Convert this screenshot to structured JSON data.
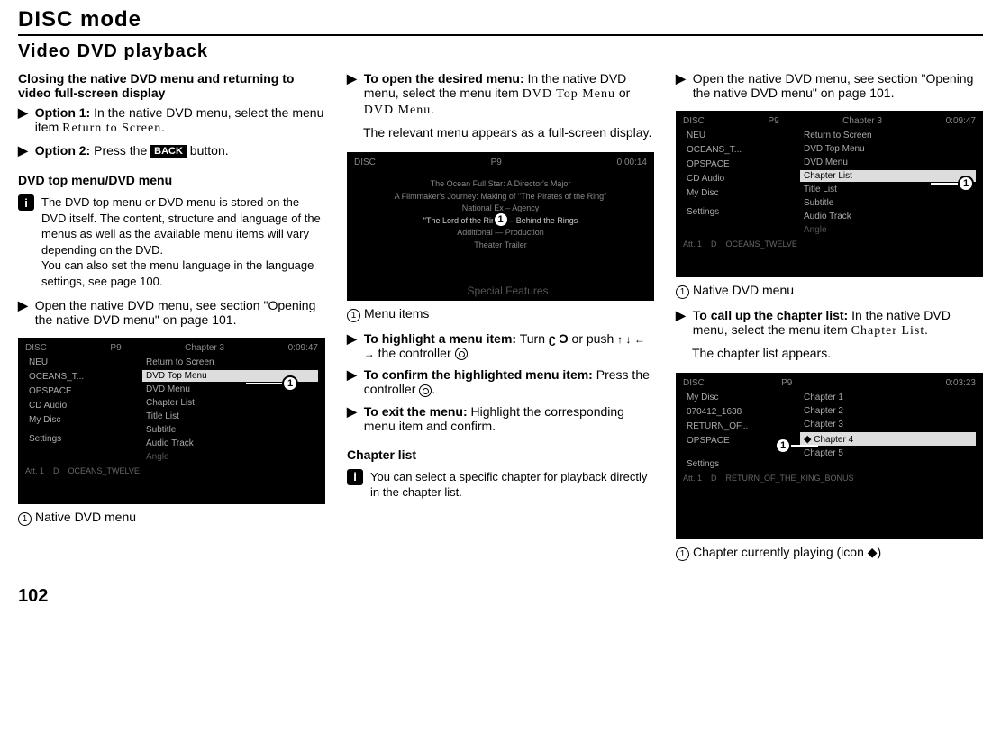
{
  "page": {
    "title": "DISC mode",
    "subtitle": "Video DVD playback",
    "pageNumber": "102"
  },
  "col1": {
    "heading1": "Closing the native DVD menu and returning to video full-screen display",
    "option1_bold": "Option 1:",
    "option1_text": " In the native DVD menu, select the menu item ",
    "option1_menu": "Return to Screen.",
    "option2_bold": "Option 2:",
    "option2_text": " Press the ",
    "option2_back": "BACK",
    "option2_text2": " button.",
    "heading2": "DVD top menu/DVD menu",
    "info1": "The DVD top menu or DVD menu is stored on the DVD itself. The content, structure and language of the menus as well as the available menu items will vary depending on the DVD.",
    "info1b": "You can also set the menu language in the language settings, see page 100.",
    "step1": "Open the native DVD menu, see section \"Opening the native DVD menu\" on page 101.",
    "caption1": "Native DVD menu",
    "shot1": {
      "header_left": "DISC",
      "header_mid": "P9",
      "header_chapter": "Chapter 3",
      "header_time": "0:09:47",
      "left": [
        "NEU",
        "OCEANS_T...",
        "OPSPACE",
        "CD Audio",
        "My Disc",
        "",
        "Settings"
      ],
      "right": [
        "Return to Screen",
        "DVD Top Menu",
        "DVD Menu",
        "Chapter List",
        "Title List",
        "Subtitle",
        "Audio Track",
        "Angle"
      ],
      "highlight_index": 1,
      "footer": [
        "Att. 1",
        "D",
        "OCEANS_TWELVE"
      ]
    }
  },
  "col2": {
    "step1_bold": "To open the desired menu:",
    "step1_text": " In the native DVD menu, select the menu item ",
    "step1_menu1": "DVD Top Menu",
    "step1_or": " or ",
    "step1_menu2": "DVD Menu.",
    "step1_after": "The relevant menu appears as a full-screen display.",
    "caption1": "Menu items",
    "step2_bold": "To highlight a menu item:",
    "step2_text1": " Turn ",
    "step2_text2": " or push ",
    "step2_text3": " the controller ",
    "step3_bold": "To confirm the highlighted menu item:",
    "step3_text": " Press the controller ",
    "step4_bold": "To exit the menu:",
    "step4_text": " Highlight the corresponding menu item and confirm.",
    "heading2": "Chapter list",
    "info1": "You can select a specific chapter for playback directly in the chapter list.",
    "shot1": {
      "header_left": "DISC",
      "header_mid": "P9",
      "header_time": "0:00:14",
      "lines": [
        "The Ocean Full Star: A Director's Major",
        "A Filmmaker's Journey: Making of \"The Pirates of the Ring\"",
        "National Ex – Agency",
        "\"The Lord of the Rings\" – Behind the Rings",
        "Additional — Production",
        "Theater Trailer"
      ],
      "sf": "Special Features"
    }
  },
  "col3": {
    "step1": "Open the native DVD menu, see section \"Opening the native DVD menu\" on page 101.",
    "caption1": "Native DVD menu",
    "step2_bold": "To call up the chapter list:",
    "step2_text": " In the native DVD menu, select the menu item ",
    "step2_menu": "Chapter List.",
    "step2_after": "The chapter list appears.",
    "caption2": "Chapter currently playing (icon ◆)",
    "shot1": {
      "header_left": "DISC",
      "header_mid": "P9",
      "header_chapter": "Chapter 3",
      "header_time": "0:09:47",
      "left": [
        "NEU",
        "OCEANS_T...",
        "OPSPACE",
        "CD Audio",
        "My Disc",
        "",
        "Settings"
      ],
      "right": [
        "Return to Screen",
        "DVD Top Menu",
        "DVD Menu",
        "Chapter List",
        "Title List",
        "Subtitle",
        "Audio Track",
        "Angle"
      ],
      "highlight_index": 3,
      "footer": [
        "Att. 1",
        "D",
        "OCEANS_TWELVE"
      ]
    },
    "shot2": {
      "header_left": "DISC",
      "header_mid": "P9",
      "header_time": "0:03:23",
      "left": [
        "My Disc",
        "070412_1638",
        "RETURN_OF...",
        "OPSPACE",
        "",
        "",
        "Settings"
      ],
      "right": [
        "Chapter 1",
        "Chapter 2",
        "Chapter 3",
        "Chapter 4",
        "Chapter 5"
      ],
      "highlight_index": 3,
      "footer": [
        "Att. 1",
        "D",
        "RETURN_OF_THE_KING_BONUS"
      ]
    }
  }
}
